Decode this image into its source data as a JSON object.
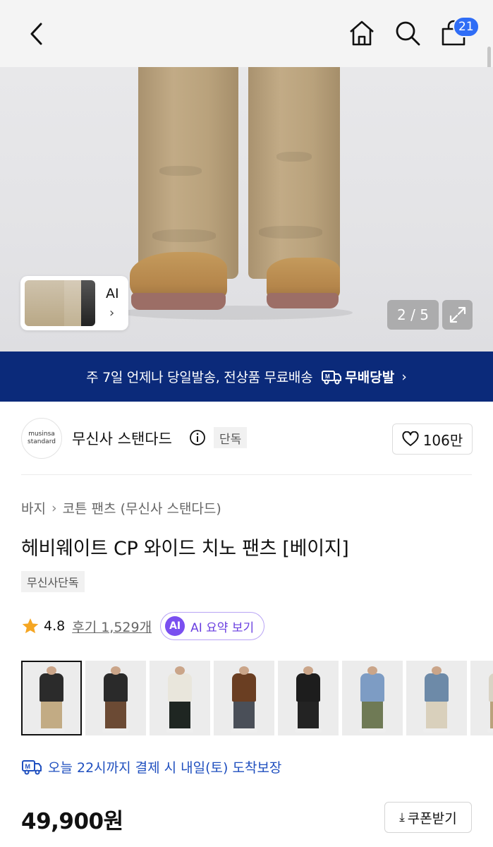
{
  "topbar": {
    "icons": [
      "back-arrow-icon",
      "home-icon",
      "search-icon",
      "cart-icon"
    ],
    "cart_count": "21"
  },
  "hero": {
    "ai_thumb_label": "AI",
    "counter": "2 / 5"
  },
  "banner": {
    "text": "주 7일 언제나 당일발송, 전상품 무료배송",
    "brand": "무배당발"
  },
  "brand": {
    "logo_line1": "musinsa",
    "logo_line2": "standard",
    "name": "무신사 스탠다드",
    "exclusive_tag": "단독",
    "likes": "106만"
  },
  "product": {
    "breadcrumb": [
      "바지",
      "코튼 팬츠 (무신사 스탠다드)"
    ],
    "title": "헤비웨이트 CP 와이드 치노 팬츠 [베이지]",
    "tag": "무신사단독",
    "rating": "4.8",
    "reviews": "후기 1,529개",
    "ai_summary_badge": "AI",
    "ai_summary_label": "AI 요약 보기",
    "delivery": "오늘 22시까지 결제 시 내일(토) 도착보장",
    "price": "49,900원",
    "coupon": "쿠폰받기"
  },
  "thumbnails": [
    {
      "top": "#2b2b2b",
      "legs": "#c2ab84",
      "selected": true
    },
    {
      "top": "#2a2a2a",
      "legs": "#6b4a34",
      "selected": false
    },
    {
      "top": "#e9e6dc",
      "legs": "#1f2622",
      "selected": false
    },
    {
      "top": "#6a3e22",
      "legs": "#4a4f58",
      "selected": false
    },
    {
      "top": "#1d1d1d",
      "legs": "#232323",
      "selected": false
    },
    {
      "top": "#7d9cc4",
      "legs": "#6f7a55",
      "selected": false
    },
    {
      "top": "#6d8aa8",
      "legs": "#d9d0bc",
      "selected": false
    },
    {
      "top": "#d9d3c4",
      "legs": "#b9a27c",
      "selected": false
    }
  ],
  "colors": {
    "banner_bg": "#0b2a7a",
    "badge_blue": "#2f6df6",
    "star": "#f5a623",
    "ai_purple": "#7a4ff0",
    "delivery_blue": "#1f4fbf"
  }
}
